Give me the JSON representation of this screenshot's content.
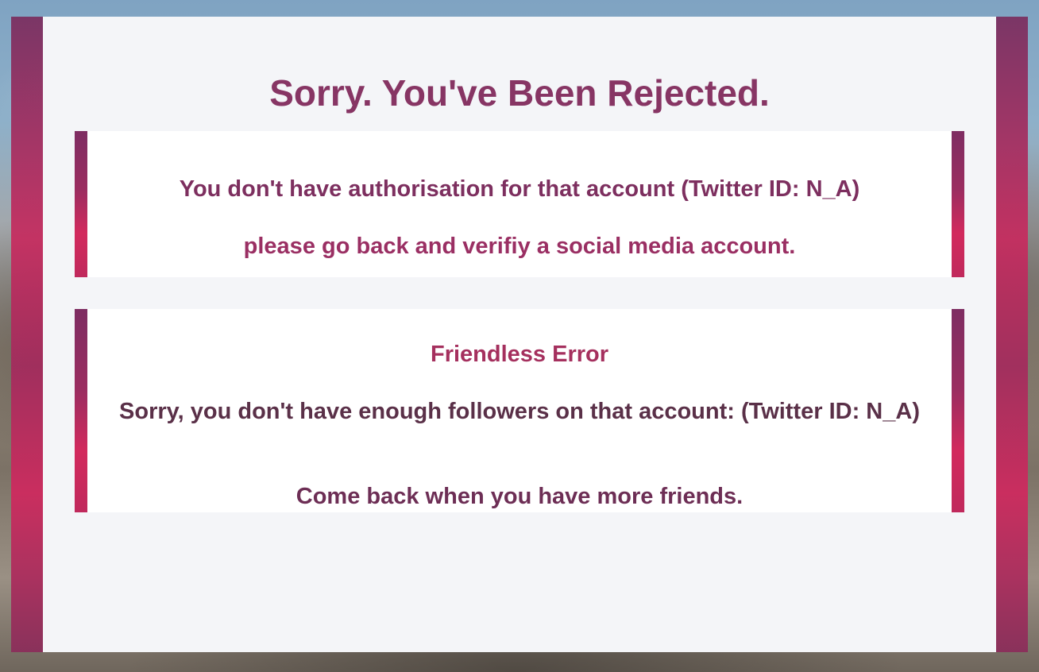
{
  "page": {
    "title": "Sorry. You've Been Rejected."
  },
  "auth_card": {
    "message": "You don't have authorisation for that account (Twitter ID: N_A)",
    "instruction": "please go back and verifiy a social media account."
  },
  "friendless_card": {
    "heading": "Friendless Error",
    "message": "Sorry, you don't have enough followers on that account: (Twitter ID: N_A)",
    "instruction": "Come back when you have more friends."
  },
  "colors": {
    "accent_title": "#873564",
    "frame_magenta": "#c72a5e",
    "panel_background": "#f4f5f8"
  }
}
